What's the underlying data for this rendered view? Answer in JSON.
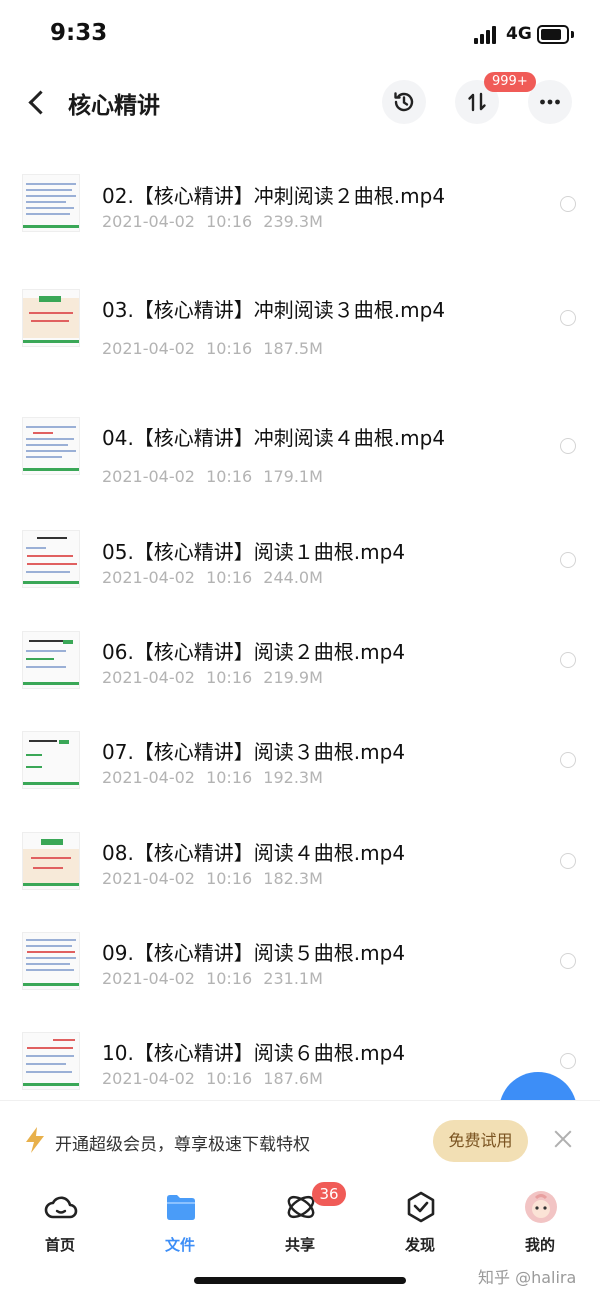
{
  "status": {
    "time": "9:33",
    "network": "4G"
  },
  "header": {
    "title": "核心精讲",
    "badge": "999+"
  },
  "files": [
    {
      "name": "02.【核心精讲】冲刺阅读２曲根.mp4",
      "date": "2021-04-02 10:16",
      "size": "239.3M"
    },
    {
      "name": "03.【核心精讲】冲刺阅读３曲根.mp4",
      "date": "2021-04-02 10:16",
      "size": "187.5M"
    },
    {
      "name": "04.【核心精讲】冲刺阅读４曲根.mp4",
      "date": "2021-04-02 10:16",
      "size": "179.1M"
    },
    {
      "name": "05.【核心精讲】阅读１曲根.mp4",
      "date": "2021-04-02 10:16",
      "size": "244.0M"
    },
    {
      "name": "06.【核心精讲】阅读２曲根.mp4",
      "date": "2021-04-02 10:16",
      "size": "219.9M"
    },
    {
      "name": "07.【核心精讲】阅读３曲根.mp4",
      "date": "2021-04-02 10:16",
      "size": "192.3M"
    },
    {
      "name": "08.【核心精讲】阅读４曲根.mp4",
      "date": "2021-04-02 10:16",
      "size": "182.3M"
    },
    {
      "name": "09.【核心精讲】阅读５曲根.mp4",
      "date": "2021-04-02 10:16",
      "size": "231.1M"
    },
    {
      "name": "10.【核心精讲】阅读６曲根.mp4",
      "date": "2021-04-02 10:16",
      "size": "187.6M"
    }
  ],
  "promo": {
    "text": "开通超级会员，尊享极速下载特权",
    "button": "免费试用"
  },
  "tabs": [
    {
      "label": "首页",
      "icon": "cloud-icon"
    },
    {
      "label": "文件",
      "icon": "folder-icon"
    },
    {
      "label": "共享",
      "icon": "share-icon",
      "badge": "36"
    },
    {
      "label": "发现",
      "icon": "discover-icon"
    },
    {
      "label": "我的",
      "icon": "avatar-icon"
    }
  ],
  "watermark": "知乎 @halira",
  "colors": {
    "accent": "#3d8ef7",
    "badge": "#f05b57",
    "trial_bg": "#f2dfb4",
    "meta": "#b3b3b3"
  }
}
